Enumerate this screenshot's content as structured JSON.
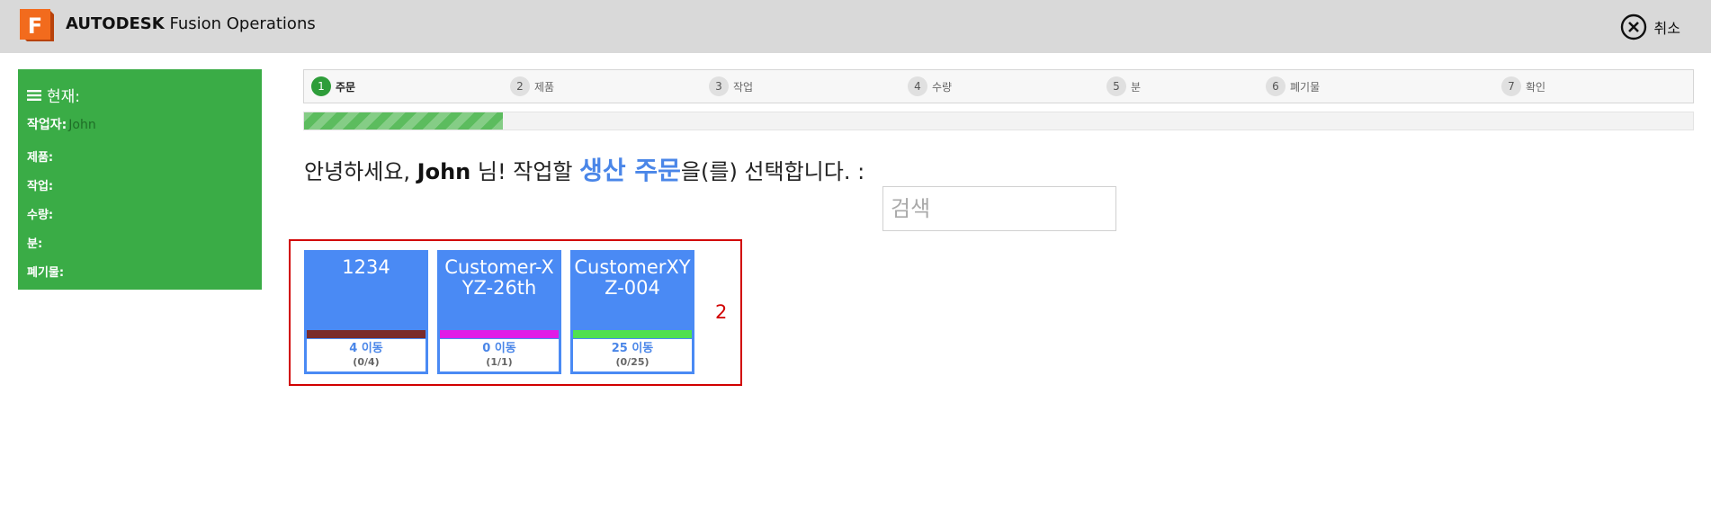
{
  "header": {
    "brand": "AUTODESK",
    "product": "Fusion Operations",
    "logo_letter": "F",
    "cancel_label": "취소",
    "cancel_icon": "close-circle-icon"
  },
  "panel": {
    "title": "현재:",
    "operator_label": "작업자:",
    "operator_value": "John",
    "product_label": "제품:",
    "operation_label": "작업:",
    "quantity_label": "수량:",
    "minutes_label": "분:",
    "scrap_label": "폐기물:"
  },
  "steps": [
    {
      "num": "1",
      "label": "주문",
      "active": true
    },
    {
      "num": "2",
      "label": "제품",
      "active": false
    },
    {
      "num": "3",
      "label": "작업",
      "active": false
    },
    {
      "num": "4",
      "label": "수량",
      "active": false
    },
    {
      "num": "5",
      "label": "분",
      "active": false
    },
    {
      "num": "6",
      "label": "폐기물",
      "active": false
    },
    {
      "num": "7",
      "label": "확인",
      "active": false
    }
  ],
  "progress": {
    "value": 0.1429
  },
  "greeting": {
    "prefix": "안녕하세요,",
    "name": "John",
    "middle": "님! 작업할",
    "accent": "생산 주문",
    "suffix": "을(를) 선택합니다. :"
  },
  "search": {
    "placeholder": "검색",
    "value": ""
  },
  "orders": [
    {
      "title": "1234",
      "bar_color": "#7a2b2b",
      "move": "4 이동",
      "count": "(0/4)"
    },
    {
      "title": "Customer-XYZ-26th",
      "bar_color": "#e01be6",
      "move": "0 이동",
      "count": "(1/1)"
    },
    {
      "title": "CustomerXYZ-004",
      "bar_color": "#4fe04f",
      "move": "25 이동",
      "count": "(0/25)"
    }
  ],
  "order_count": "2",
  "colors": {
    "accent": "#4a86e8",
    "panel_green": "#3aac46",
    "card_blue": "#4a8af4",
    "annotation_red": "#d10000"
  }
}
